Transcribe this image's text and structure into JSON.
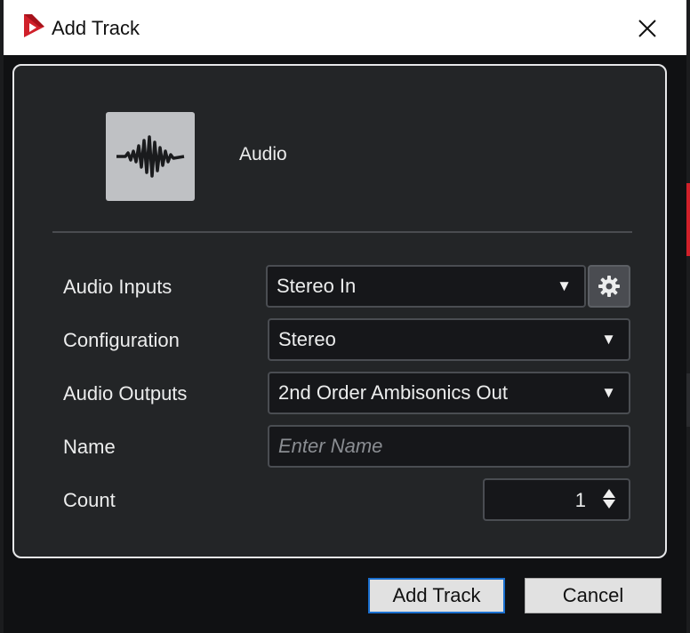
{
  "window": {
    "title": "Add Track"
  },
  "track": {
    "type_label": "Audio",
    "icon": "audio-waveform-icon"
  },
  "form": {
    "audio_inputs": {
      "label": "Audio Inputs",
      "value": "Stereo In"
    },
    "configuration": {
      "label": "Configuration",
      "value": "Stereo"
    },
    "audio_outputs": {
      "label": "Audio Outputs",
      "value": "2nd Order Ambisonics Out"
    },
    "name": {
      "label": "Name",
      "value": "",
      "placeholder": "Enter Name"
    },
    "count": {
      "label": "Count",
      "value": "1"
    }
  },
  "buttons": {
    "add_track": "Add Track",
    "cancel": "Cancel"
  },
  "colors": {
    "panel": "#232527",
    "field": "#16171a",
    "accent_blue": "#1a6fcf",
    "logo_red": "#d0202a"
  }
}
